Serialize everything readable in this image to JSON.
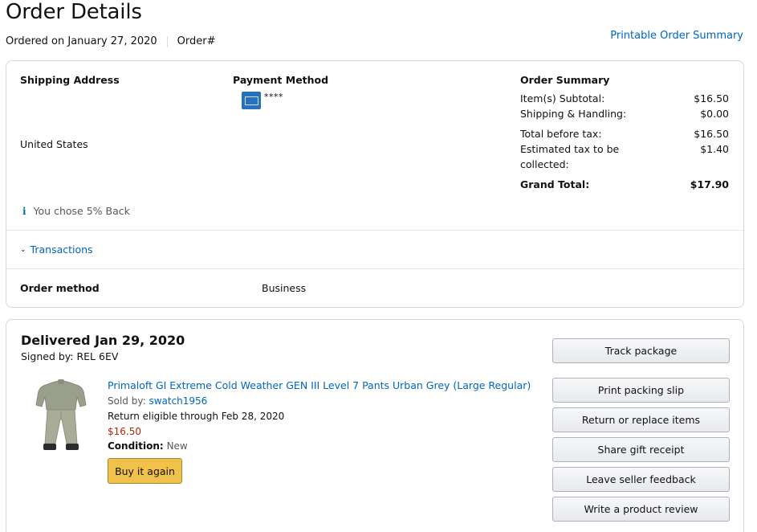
{
  "page": {
    "title": "Order Details",
    "ordered_on": "Ordered on January 27, 2020",
    "order_number_label": "Order#",
    "printable_link": "Printable Order Summary"
  },
  "shipping": {
    "heading": "Shipping Address",
    "country": "United States"
  },
  "payment": {
    "heading": "Payment Method",
    "card_icon": "amex-card-icon",
    "masked_number": "****"
  },
  "summary": {
    "heading": "Order Summary",
    "rows": [
      {
        "label": "Item(s) Subtotal:",
        "value": "$16.50"
      },
      {
        "label": "Shipping & Handling:",
        "value": "$0.00"
      },
      {
        "label": "Total before tax:",
        "value": "$16.50"
      },
      {
        "label": "Estimated tax to be collected:",
        "value": "$1.40"
      }
    ],
    "grand_total_label": "Grand Total:",
    "grand_total_value": "$17.90"
  },
  "reward": {
    "icon": "info-icon",
    "text": "You chose 5% Back"
  },
  "transactions": {
    "label": "Transactions"
  },
  "order_method": {
    "label": "Order method",
    "value": "Business"
  },
  "shipment": {
    "status": "Delivered Jan 29, 2020",
    "signed_by": "Signed by: REL 6EV",
    "product": {
      "title": "Primaloft GI Extreme Cold Weather GEN III Level 7 Pants Urban Grey (Large Regular)",
      "sold_by_label": "Sold by:",
      "seller": "swatch1956",
      "return_text": "Return eligible through Feb 28, 2020",
      "price": "$16.50",
      "condition_label": "Condition:",
      "condition_value": "New",
      "buy_again": "Buy it again"
    },
    "actions": [
      "Track package",
      "Print packing slip",
      "Return or replace items",
      "Share gift receipt",
      "Leave seller feedback",
      "Write a product review"
    ]
  },
  "colors": {
    "link": "#0066c0",
    "price": "#b12704",
    "buy_button": "#f0c14b",
    "border": "#d5d9d9"
  }
}
